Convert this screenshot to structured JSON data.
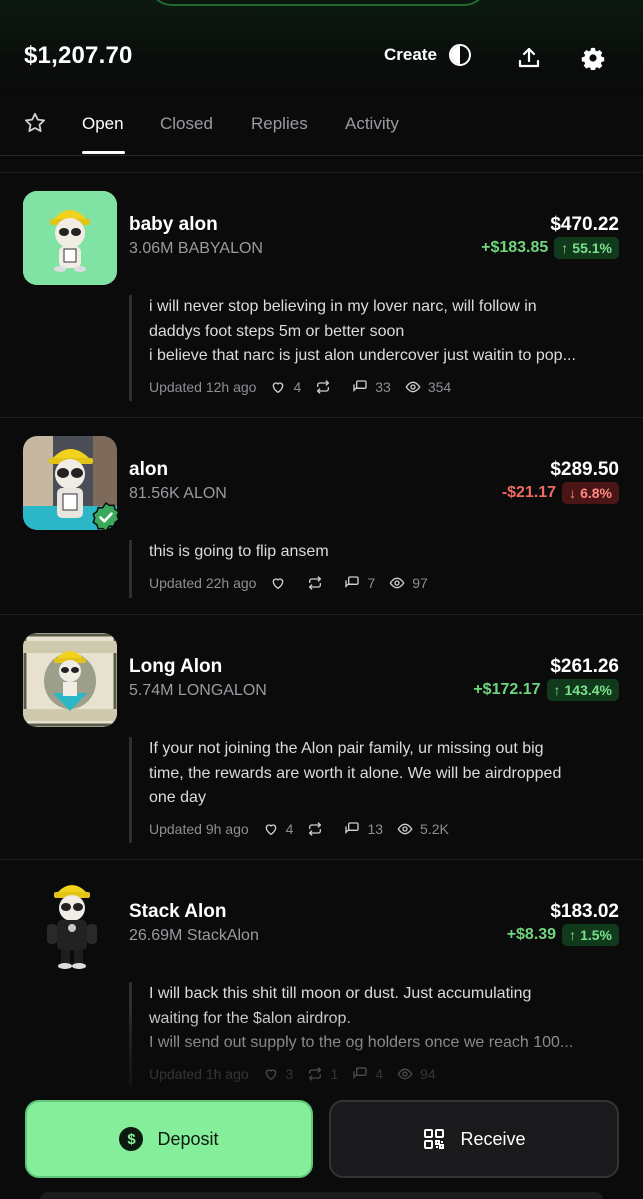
{
  "header": {
    "balance": "$1,207.70",
    "create_label": "Create",
    "icons": [
      "half-circle-icon",
      "upload-icon",
      "gear-icon"
    ]
  },
  "tabs": {
    "items": [
      "Open",
      "Closed",
      "Replies",
      "Activity"
    ],
    "active": "Open"
  },
  "cards": [
    {
      "name": "baby alon",
      "holding": "3.06M BABYALON",
      "value": "$470.22",
      "pnl": "+$183.85",
      "pct": "55.1%",
      "direction": "up",
      "post_lines": [
        "i will never stop believing in my lover narc, will follow in",
        "daddys foot steps 5m or better soon",
        "i believe that narc is just alon undercover just waitin to pop..."
      ],
      "updated": "Updated 12h ago",
      "likes": "4",
      "reposts": "",
      "replies": "33",
      "views": "354"
    },
    {
      "name": "alon",
      "holding": "81.56K ALON",
      "value": "$289.50",
      "pnl": "-$21.17",
      "pct": "6.8%",
      "direction": "down",
      "post_lines": [
        "this is going to flip ansem"
      ],
      "updated": "Updated 22h ago",
      "likes": "",
      "reposts": "",
      "replies": "7",
      "views": "97"
    },
    {
      "name": "Long Alon",
      "holding": "5.74M LONGALON",
      "value": "$261.26",
      "pnl": "+$172.17",
      "pct": "143.4%",
      "direction": "up",
      "post_lines": [
        "If your not joining the Alon pair family, ur missing out big",
        "time, the rewards are worth it alone. We will be airdropped",
        "one day"
      ],
      "updated": "Updated 9h ago",
      "likes": "4",
      "reposts": "",
      "replies": "13",
      "views": "5.2K"
    },
    {
      "name": "Stack Alon",
      "holding": "26.69M StackAlon",
      "value": "$183.02",
      "pnl": "+$8.39",
      "pct": "1.5%",
      "direction": "up",
      "post_lines": [
        "I will back this shit till moon or dust. Just accumulating",
        "waiting for the $alon airdrop.",
        "I will send out supply to the og holders once we reach 100..."
      ],
      "updated": "Updated 1h ago",
      "likes": "3",
      "reposts": "1",
      "replies": "4",
      "views": "94"
    }
  ],
  "bottom": {
    "deposit_label": "Deposit",
    "receive_label": "Receive"
  },
  "colors": {
    "accent_green": "#84ee9b",
    "gain": "#6fd67e",
    "loss": "#ef6b62",
    "background": "#0b0b0c"
  }
}
